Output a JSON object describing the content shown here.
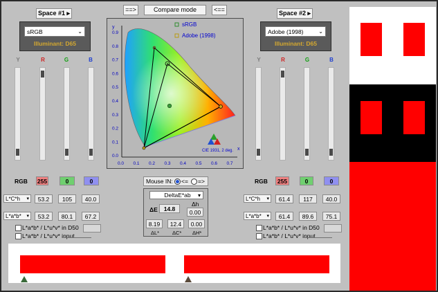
{
  "nav": {
    "left_arrow": "==>",
    "mode": "Compare mode",
    "right_arrow": "<=="
  },
  "space1": {
    "button": "Space #1",
    "profile": "sRGB",
    "illuminant": "Illuminant: D65",
    "channels": [
      "Y",
      "R",
      "G",
      "B"
    ],
    "rgb_label": "RGB",
    "rgb": [
      "255",
      "0",
      "0"
    ],
    "lch_label": "L*C*h",
    "lch": [
      "53.2",
      "105",
      "40.0"
    ],
    "lab_label": "L*a*b*",
    "lab": [
      "53.2",
      "80.1",
      "67.2"
    ],
    "cb1": "L*a*b* / L*u*v* in D50",
    "cb2": "L*a*b* / L*u*v* input",
    "levels": [
      0.05,
      0.95,
      0.05,
      0.05
    ]
  },
  "space2": {
    "button": "Space #2",
    "profile": "Adobe (1998)",
    "illuminant": "Illuminant: D65",
    "channels": [
      "Y",
      "R",
      "G",
      "B"
    ],
    "rgb_label": "RGB",
    "rgb": [
      "255",
      "0",
      "0"
    ],
    "lch_label": "L*C*h",
    "lch": [
      "61.4",
      "117",
      "40.0"
    ],
    "lab_label": "L*a*b*",
    "lab": [
      "61.4",
      "89.6",
      "75.1"
    ],
    "cb1": "L*a*b* / L*u*v* in D50",
    "cb2": "L*a*b* / L*u*v* input",
    "levels": [
      0.05,
      0.95,
      0.05,
      0.05
    ]
  },
  "chart": {
    "legend": [
      "sRGB",
      "Adobe (1998)"
    ],
    "caption": "CIE 1931, 2 deg.",
    "xlabel": "x",
    "ylabel": "y",
    "ticks_x": [
      "0.0",
      "0.1",
      "0.2",
      "0.3",
      "0.4",
      "0.5",
      "0.6",
      "0.7"
    ],
    "ticks_y": [
      "0.9",
      "0.8",
      "0.7",
      "0.6",
      "0.5",
      "0.4",
      "0.3",
      "0.2",
      "0.1",
      "0.0"
    ]
  },
  "center": {
    "mouse_in": "Mouse IN:",
    "opt1": "<=",
    "opt2": "=>",
    "metric": "DeltaE*ab",
    "de_label": "ΔE",
    "de": "14.8",
    "dh_label": "Δh",
    "dh": "0.00",
    "dl": "8.19",
    "dc": "12.4",
    "dhh": "0.00",
    "dl_label": "ΔL*",
    "dc_label": "ΔC*",
    "dhh_label": "ΔH*"
  },
  "colors": {
    "patch": "#ff0000",
    "gamut_srgb": "#2e8b2e",
    "gamut_adobe": "#b89a10",
    "accent": "#d4a830"
  }
}
